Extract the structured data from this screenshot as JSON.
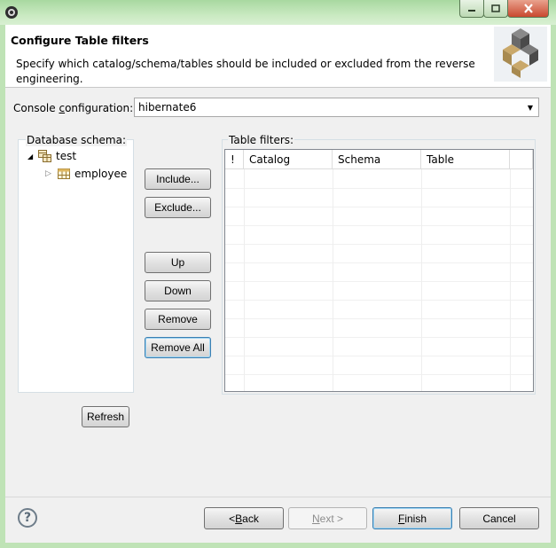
{
  "window": {
    "title": ""
  },
  "header": {
    "title": "Configure Table filters",
    "description": "Specify which catalog/schema/tables should be included or excluded from the reverse engineering."
  },
  "console": {
    "label_pre": "Console ",
    "label_ul": "c",
    "label_post": "onfiguration:",
    "value": "hibernate6"
  },
  "schema": {
    "label": "Database schema:",
    "tree": [
      {
        "label": "test",
        "expanded": true,
        "icon": "database-icon"
      },
      {
        "label": "employee",
        "expanded": false,
        "icon": "table-icon"
      }
    ],
    "refresh_label": "Refresh"
  },
  "middle_buttons": {
    "include": "Include...",
    "exclude": "Exclude...",
    "up": "Up",
    "down": "Down",
    "remove": "Remove",
    "remove_all": "Remove All"
  },
  "filters": {
    "label": "Table filters:",
    "columns": [
      "!",
      "Catalog",
      "Schema",
      "Table"
    ],
    "rows": []
  },
  "footer": {
    "back_pre": "< ",
    "back_ul": "B",
    "back_post": "ack",
    "next_pre": "",
    "next_ul": "N",
    "next_post": "ext >",
    "finish_pre": "",
    "finish_ul": "F",
    "finish_post": "inish",
    "cancel": "Cancel"
  }
}
